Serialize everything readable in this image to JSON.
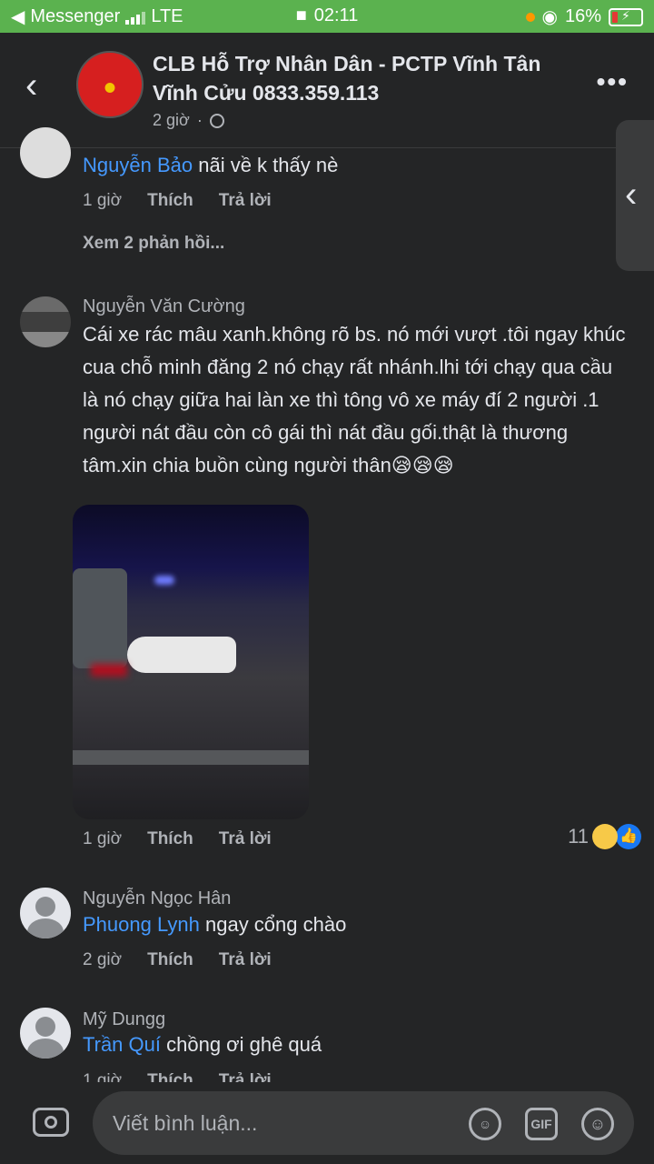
{
  "status_bar": {
    "back_app": "Messenger",
    "network": "LTE",
    "time": "02:11",
    "battery": "16%"
  },
  "header": {
    "title": "CLB Hỗ Trợ Nhân Dân - PCTP Vĩnh Tân Vĩnh Cửu 0833.359.113",
    "time": "2 giờ",
    "back_icon": "chevron-left-icon",
    "more_icon": "more-icon"
  },
  "comments": [
    {
      "author": "",
      "mention": "Nguyễn Bảo",
      "text": "nãi về k thấy nè",
      "time": "1 giờ",
      "like_label": "Thích",
      "reply_label": "Trả lời",
      "see_replies": "Xem 2 phản hồi..."
    },
    {
      "author": "Nguyễn Văn Cường",
      "text": "Cái xe rác mâu xanh.không rõ bs. nó mới vượt .tôi ngay khúc cua chỗ minh đăng 2 nó chạy rất nhánh.lhi tới chạy qua cầu là nó chạy giữa hai làn xe thì tông vô xe máy đí 2 người .1 người nát đầu còn cô gái thì nát đầu gối.thật là thương tâm.xin chia buồn cùng người thân😪😪😪",
      "time": "1 giờ",
      "like_label": "Thích",
      "reply_label": "Trả lời",
      "reaction_count": "11"
    },
    {
      "author": "Nguyễn Ngọc Hân",
      "mention": "Phuong Lynh",
      "text": "ngay cổng chào",
      "time": "2 giờ",
      "like_label": "Thích",
      "reply_label": "Trả lời"
    },
    {
      "author": "Mỹ Dungg",
      "mention": "Trần Quí",
      "text": "chồng ơi ghê quá",
      "time": "1 giờ",
      "like_label": "Thích",
      "reply_label": "Trả lời"
    }
  ],
  "composer": {
    "placeholder": "Viết bình luận...",
    "gif_label": "GIF"
  }
}
